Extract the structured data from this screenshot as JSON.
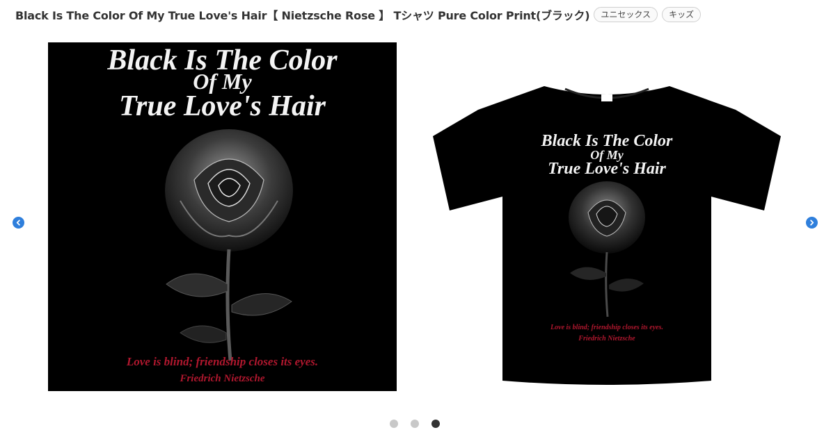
{
  "product": {
    "title": "Black Is The Color Of My True Love's Hair【 Nietzsche Rose 】 Tシャツ Pure Color Print(ブラック)",
    "tags": [
      "ユニセックス",
      "キッズ"
    ]
  },
  "design": {
    "line1": "Black Is The Color",
    "line2": "Of My",
    "line3": "True Love's Hair",
    "quote": "Love is blind; friendship closes its eyes.",
    "author": "Friedrich Nietzsche"
  },
  "carousel": {
    "prev_icon": "chevron-left-circle-icon",
    "next_icon": "chevron-right-circle-icon",
    "slide_count": 3,
    "active_index": 2,
    "accent_color": "#2f7fdc"
  },
  "colors": {
    "shirt": "#000000",
    "quote_text": "#b0172e"
  }
}
